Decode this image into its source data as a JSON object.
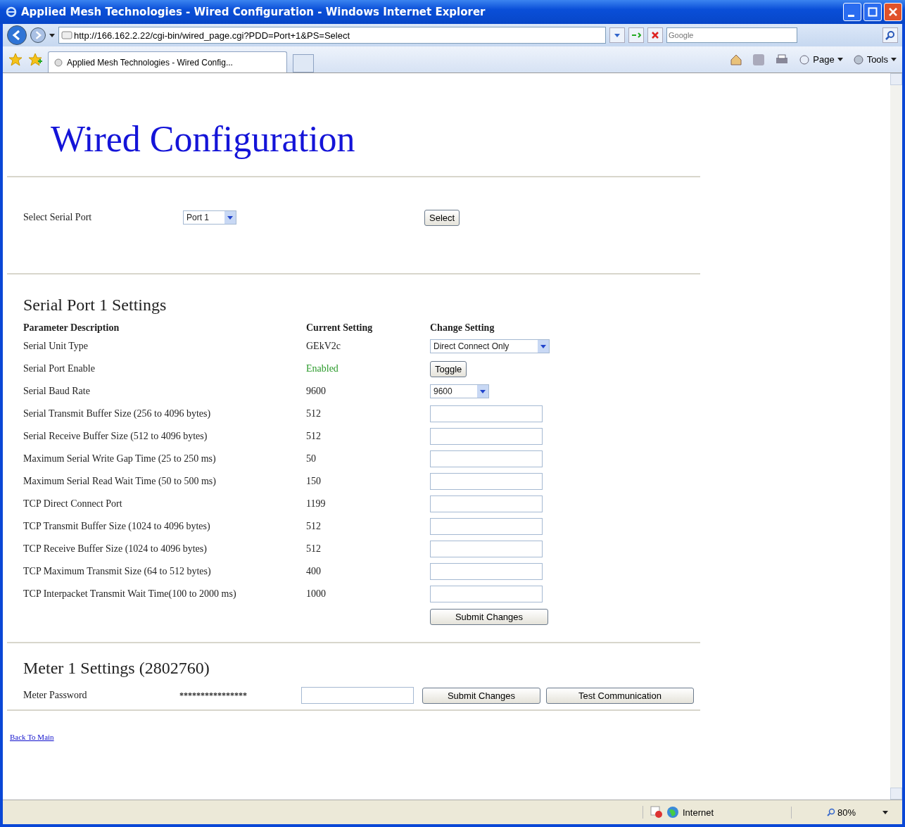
{
  "window": {
    "title": "Applied Mesh Technologies - Wired Configuration - Windows Internet Explorer"
  },
  "address_bar": {
    "url": "http://166.162.2.22/cgi-bin/wired_page.cgi?PDD=Port+1&PS=Select",
    "search_placeholder": "Google"
  },
  "tabs": [
    {
      "label": "Applied Mesh Technologies - Wired Config...",
      "selected": true
    }
  ],
  "command_bar": [
    {
      "label": "Page"
    },
    {
      "label": "Tools"
    }
  ],
  "page": {
    "heading": "Wired Configuration",
    "port_select": {
      "label": "Select Serial Port",
      "value": "Port 1",
      "button": "Select"
    },
    "section_title": "Serial Port 1 Settings",
    "columns": [
      "Parameter Description",
      "Current Setting",
      "Change Setting"
    ],
    "rows": [
      {
        "description": "Serial Unit Type",
        "current": "GEkV2c",
        "kind": "select",
        "value": "Direct Connect Only"
      },
      {
        "description": "Serial Port Enable",
        "current": "Enabled",
        "kind": "toggle",
        "enabled": true,
        "button": "Toggle"
      },
      {
        "description": "Serial Baud Rate",
        "current": "9600",
        "kind": "select",
        "value": "9600"
      },
      {
        "description": "Serial Transmit Buffer Size (256 to 4096 bytes)",
        "current": "512",
        "kind": "input"
      },
      {
        "description": "Serial Receive Buffer Size (512 to 4096 bytes)",
        "current": "512",
        "kind": "input"
      },
      {
        "description": "Maximum Serial Write Gap Time (25 to 250 ms)",
        "current": "50",
        "kind": "input"
      },
      {
        "description": "Maximum Serial Read Wait Time (50 to 500 ms)",
        "current": "150",
        "kind": "input"
      },
      {
        "description": "TCP Direct Connect Port",
        "current": "1199",
        "kind": "input"
      },
      {
        "description": "TCP Transmit Buffer Size (1024 to 4096 bytes)",
        "current": "512",
        "kind": "input"
      },
      {
        "description": "TCP Receive Buffer Size (1024 to 4096 bytes)",
        "current": "512",
        "kind": "input"
      },
      {
        "description": "TCP Maximum Transmit Size (64 to 512 bytes)",
        "current": "400",
        "kind": "input"
      },
      {
        "description": "TCP Interpacket Transmit Wait Time(100 to 2000 ms)",
        "current": "1000",
        "kind": "input"
      }
    ],
    "submit_button": "Submit Changes",
    "meter_title": "Meter 1 Settings (2802760)",
    "meter": {
      "label": "Meter Password",
      "current": "****************",
      "submit_button": "Submit Changes",
      "test_button": "Test Communication"
    },
    "back_link": "Back To Main"
  },
  "status_bar": {
    "zone": "Internet",
    "zoom": "80%"
  }
}
